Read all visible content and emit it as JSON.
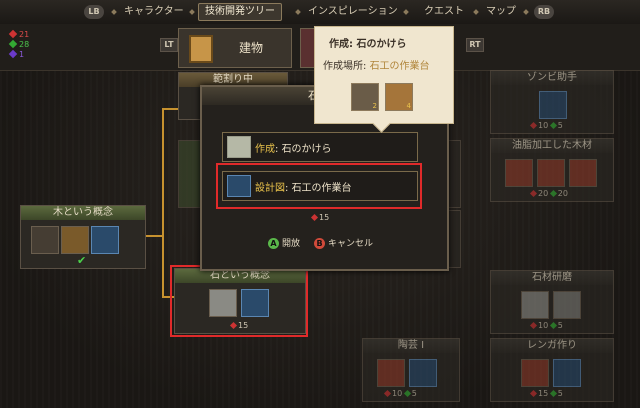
{
  "nav": {
    "lb": "LB",
    "rb": "RB",
    "tabs": [
      {
        "label": "キャラクター",
        "active": false
      },
      {
        "label": "技術開発ツリー",
        "active": true
      },
      {
        "label": "インスピレーション",
        "active": false
      },
      {
        "label": "クエスト",
        "active": false
      },
      {
        "label": "マップ",
        "active": false
      }
    ]
  },
  "resources": {
    "red": "21",
    "green": "28",
    "purple": "1"
  },
  "category": {
    "lt": "LT",
    "rt": "RT",
    "tab_label": "建物",
    "wall_node_title": "範割り中"
  },
  "tree": {
    "wood_concept": {
      "title": "木という概念"
    },
    "stone_concept": {
      "title": "石という概念",
      "cost": "15"
    },
    "zombie": {
      "title": "ゾンビ助手",
      "cost_red": "10",
      "cost_green": "5"
    },
    "oil_wood": {
      "title": "油脂加工した木材",
      "cost_red": "20",
      "cost_green": "20"
    },
    "stone_polish": {
      "title": "石材研磨",
      "cost_red": "10",
      "cost_green": "5"
    },
    "pottery": {
      "title": "陶芸 I",
      "cost_red": "10",
      "cost_green": "5"
    },
    "brick": {
      "title": "レンガ作り",
      "cost_red": "15",
      "cost_green": "5"
    }
  },
  "dialog": {
    "title": "石とい",
    "craft_label": "作成",
    "craft_value": "石のかけら",
    "blueprint_label": "設計図",
    "blueprint_value": "石工の作業台",
    "cost": "15",
    "unlock_key": "A",
    "unlock_label": "開放",
    "cancel_key": "B",
    "cancel_label": "キャンセル"
  },
  "tooltip": {
    "title": "作成: 石のかけら",
    "location_label": "作成場所:",
    "location_value": "石工の作業台",
    "mat1_count": "2",
    "mat2_count": "4"
  },
  "colors": {
    "accent_gold": "#e9c24b",
    "highlight_red": "#e02a2a",
    "tree_line": "#c7922f"
  }
}
